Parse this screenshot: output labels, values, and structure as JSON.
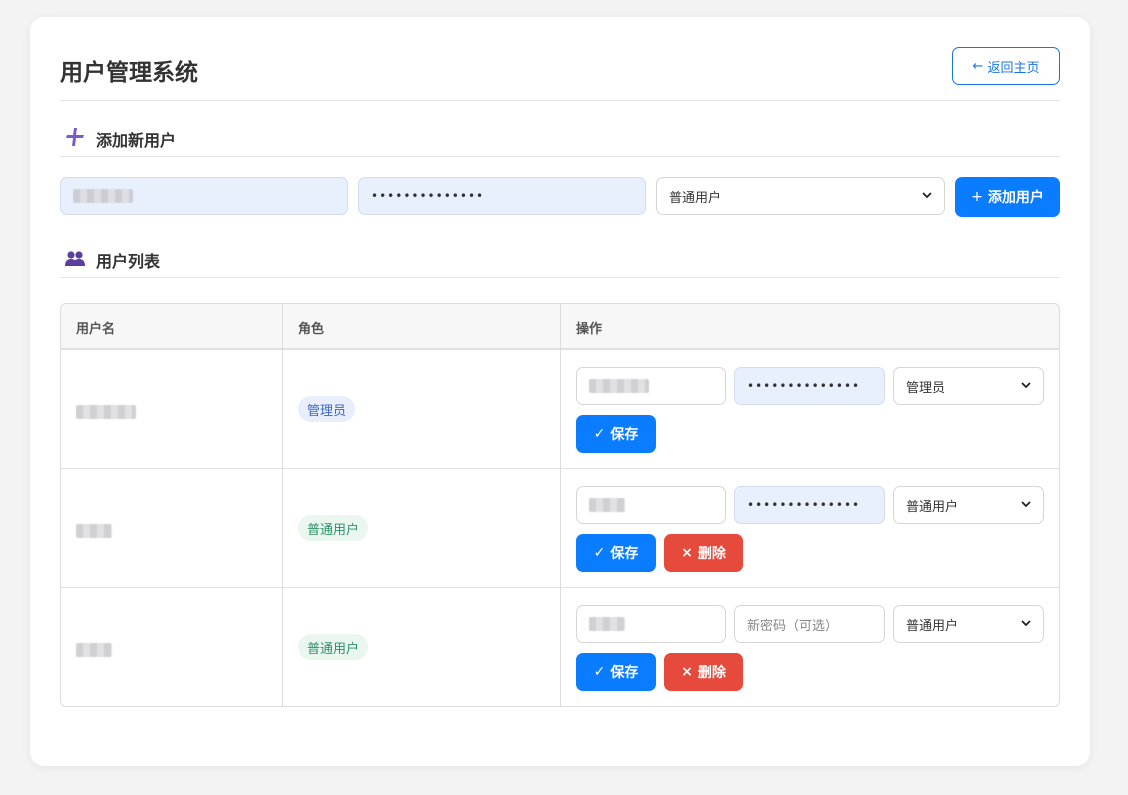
{
  "header": {
    "title": "用户管理系统",
    "back_label": "返回主页",
    "back_arrow": "←"
  },
  "add_section": {
    "title": "添加新用户",
    "password_mask": "••••••••••••••",
    "role_selected": "普通用户",
    "add_button": "添加用户",
    "add_prefix": "+"
  },
  "list_section": {
    "title": "用户列表",
    "columns": [
      "用户名",
      "角色",
      "操作"
    ],
    "rows": [
      {
        "role": "管理员",
        "password_mask": "••••••••••••••",
        "password_placeholder": "",
        "role_selected": "管理员",
        "save_label": "保存"
      },
      {
        "role": "普通用户",
        "password_mask": "••••••••••••••",
        "password_placeholder": "",
        "role_selected": "普通用户",
        "save_label": "保存",
        "delete_label": "删除"
      },
      {
        "role": "普通用户",
        "password_mask": "",
        "password_placeholder": "新密码（可选）",
        "role_selected": "普通用户",
        "save_label": "保存",
        "delete_label": "删除"
      }
    ]
  },
  "icons": {
    "check": "✓",
    "cross": "×",
    "chevron": "⌄"
  },
  "colors": {
    "primary": "#0a7cff",
    "danger": "#e64a3c",
    "accent_purple": "#6c4fc4"
  }
}
